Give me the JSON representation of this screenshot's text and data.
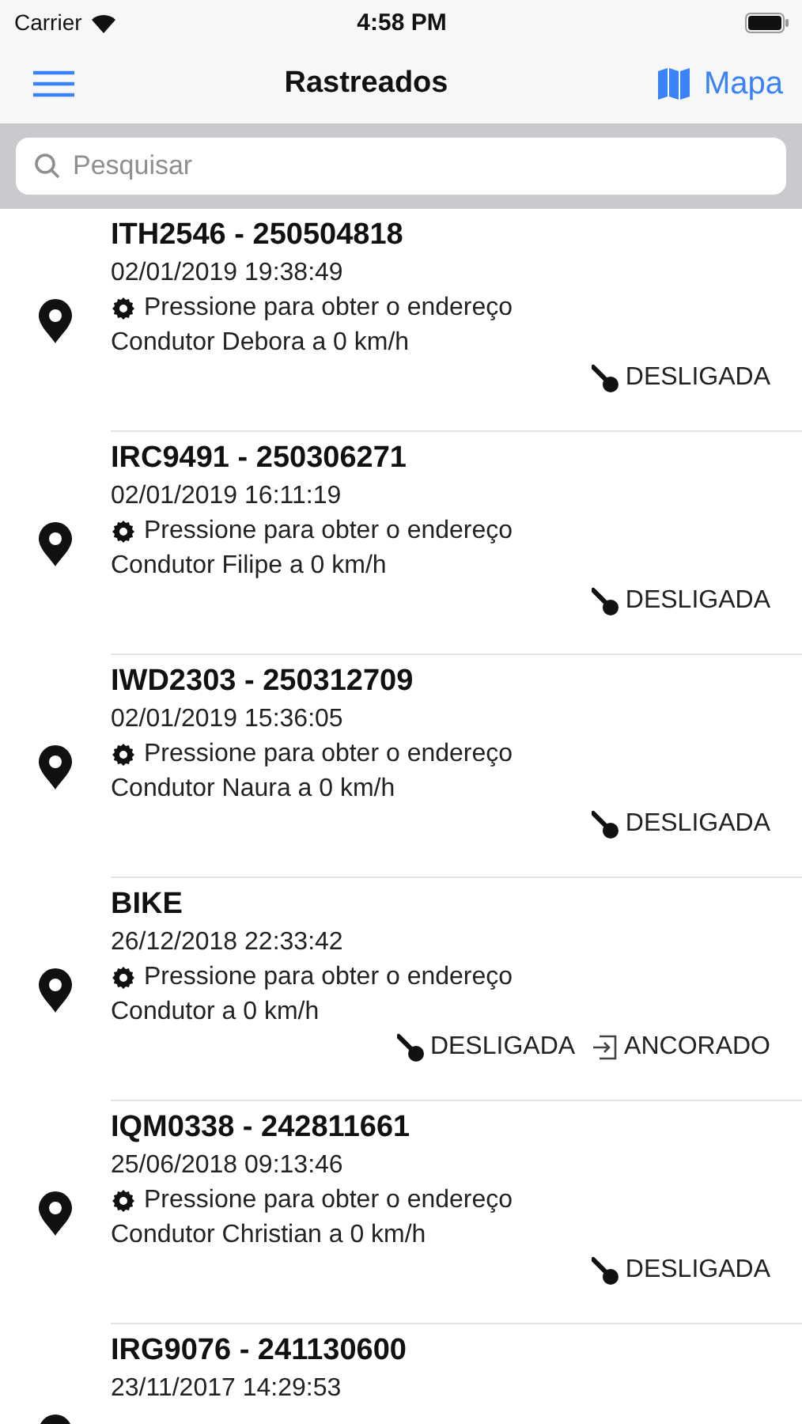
{
  "status_bar": {
    "carrier": "Carrier",
    "time": "4:58 PM"
  },
  "nav": {
    "title": "Rastreados",
    "map_button": "Mapa"
  },
  "search": {
    "placeholder": "Pesquisar"
  },
  "vehicles": [
    {
      "title": "ITH2546 - 250504818",
      "datetime": "02/01/2019 19:38:49",
      "address": "Pressione para obter o endereço",
      "driver": "Condutor Debora a 0 km/h",
      "statuses": [
        {
          "kind": "ignition",
          "label": "DESLIGADA"
        }
      ]
    },
    {
      "title": "IRC9491 - 250306271",
      "datetime": "02/01/2019 16:11:19",
      "address": "Pressione para obter o endereço",
      "driver": "Condutor Filipe a 0 km/h",
      "statuses": [
        {
          "kind": "ignition",
          "label": "DESLIGADA"
        }
      ]
    },
    {
      "title": "IWD2303 - 250312709",
      "datetime": "02/01/2019 15:36:05",
      "address": "Pressione para obter o endereço",
      "driver": "Condutor Naura a 0 km/h",
      "statuses": [
        {
          "kind": "ignition",
          "label": "DESLIGADA"
        }
      ]
    },
    {
      "title": "BIKE",
      "datetime": "26/12/2018 22:33:42",
      "address": "Pressione para obter o endereço",
      "driver": "Condutor a 0 km/h",
      "statuses": [
        {
          "kind": "ignition",
          "label": "DESLIGADA"
        },
        {
          "kind": "anchored",
          "label": "ANCORADO"
        }
      ]
    },
    {
      "title": "IQM0338 - 242811661",
      "datetime": "25/06/2018 09:13:46",
      "address": "Pressione para obter o endereço",
      "driver": "Condutor Christian a 0 km/h",
      "statuses": [
        {
          "kind": "ignition",
          "label": "DESLIGADA"
        }
      ]
    },
    {
      "title": "IRG9076 - 241130600",
      "datetime": "23/11/2017 14:29:53"
    }
  ]
}
